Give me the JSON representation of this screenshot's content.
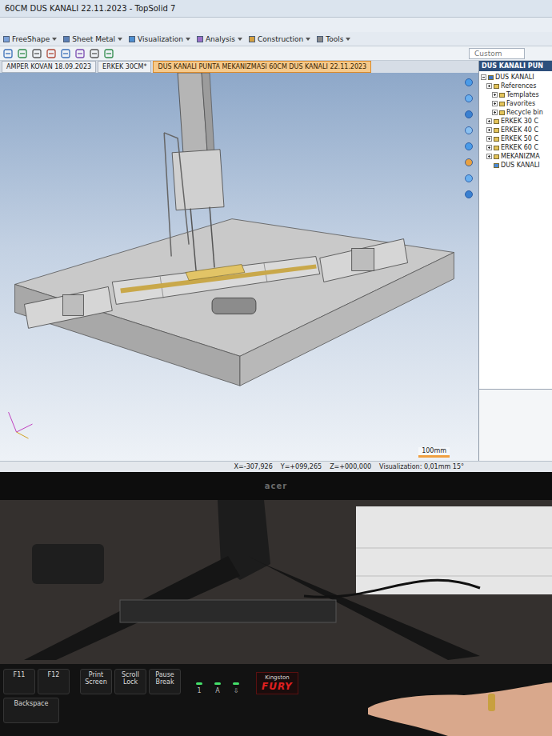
{
  "window": {
    "title": "60CM DUS KANALI 22.11.2023 - TopSolid 7"
  },
  "menu": [
    {
      "label": "FreeShape"
    },
    {
      "label": "Sheet Metal"
    },
    {
      "label": "Visualization"
    },
    {
      "label": "Analysis"
    },
    {
      "label": "Construction"
    },
    {
      "label": "Tools"
    }
  ],
  "toolbar": {
    "custom_field": "Custom"
  },
  "tabs": [
    {
      "label": "AMPER KOVAN 18.09.2023",
      "selected": false
    },
    {
      "label": "ERKEK 30CM*",
      "selected": false
    },
    {
      "label": "DUS KANALI PUNTA MEKANIZMASI 60CM DUS KANALI 22.11.2023",
      "selected": true
    }
  ],
  "tree": {
    "title": "DUS KANALI PUN",
    "items": [
      {
        "label": "DUS KANALI",
        "depth": 0,
        "kind": "project",
        "expanded": true
      },
      {
        "label": "References",
        "depth": 1,
        "kind": "folder",
        "expanded": false
      },
      {
        "label": "Templates",
        "depth": 2,
        "kind": "folder",
        "expanded": false
      },
      {
        "label": "Favorites",
        "depth": 2,
        "kind": "folder",
        "expanded": false
      },
      {
        "label": "Recycle bin",
        "depth": 2,
        "kind": "folder",
        "expanded": false
      },
      {
        "label": "ERKEK 30 C",
        "depth": 1,
        "kind": "folder",
        "expanded": false
      },
      {
        "label": "ERKEK 40 C",
        "depth": 1,
        "kind": "folder",
        "expanded": false
      },
      {
        "label": "ERKEK 50 C",
        "depth": 1,
        "kind": "folder",
        "expanded": false
      },
      {
        "label": "ERKEK 60 C",
        "depth": 1,
        "kind": "folder",
        "expanded": false
      },
      {
        "label": "MEKANIZMA",
        "depth": 1,
        "kind": "folder",
        "expanded": false
      },
      {
        "label": "DUS KANALI",
        "depth": 1,
        "kind": "document",
        "expanded": false
      }
    ]
  },
  "viewport": {
    "scale": "100mm"
  },
  "status_bar": {
    "x": "X=-307,926",
    "y": "Y=+099,265",
    "z": "Z=+000,000",
    "visualization": "Visualization: 0,01mm 15°"
  },
  "monitor": {
    "brand": "acer"
  },
  "keyboard": {
    "function_keys": [
      "F11",
      "F12"
    ],
    "system_keys": [
      "Print Screen",
      "Scroll Lock",
      "Pause Break"
    ],
    "indicators": [
      {
        "label": "1",
        "on": true
      },
      {
        "label": "A",
        "on": true
      },
      {
        "label": "⇩",
        "on": true
      }
    ],
    "brand": {
      "small": "Kingston",
      "big": "FURY"
    },
    "second_row": [
      "Backspace"
    ]
  }
}
